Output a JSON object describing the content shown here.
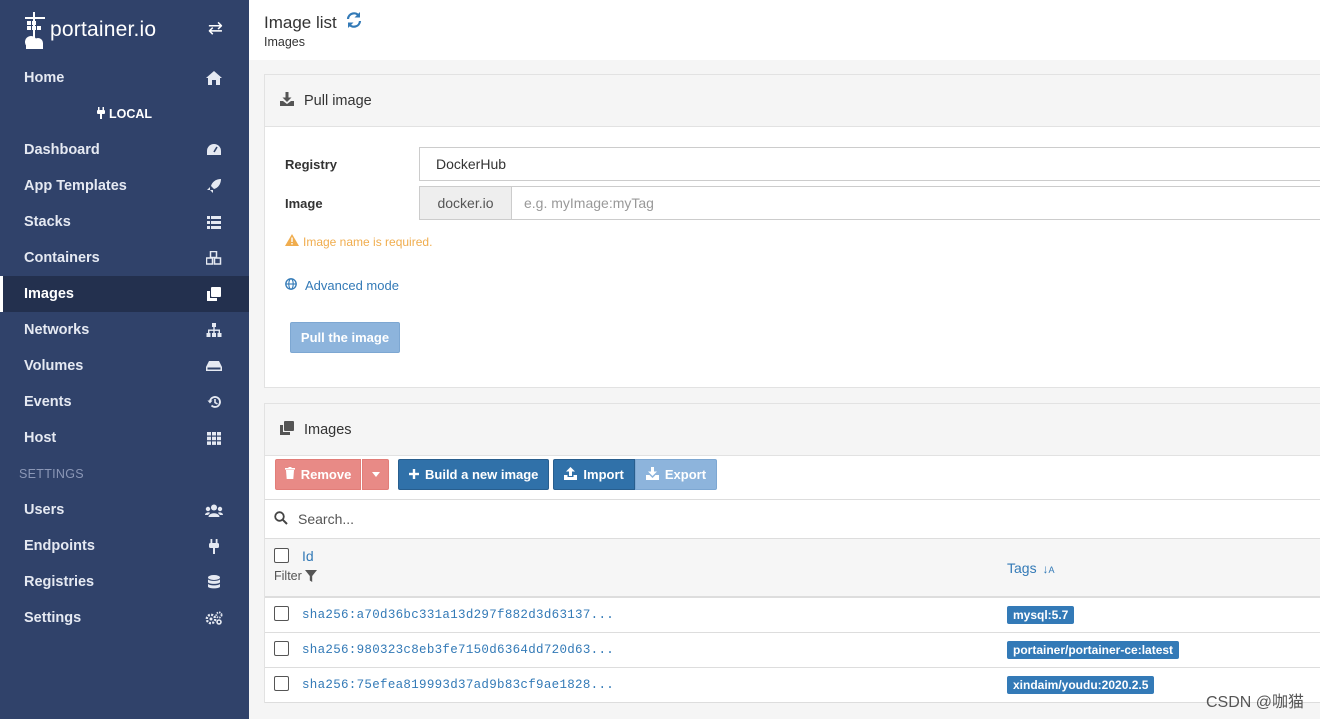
{
  "app": {
    "logo_text": "portainer.io"
  },
  "sidebar": {
    "home": "Home",
    "endpoint": "LOCAL",
    "items": [
      {
        "label": "Dashboard",
        "icon": "tachometer-icon"
      },
      {
        "label": "App Templates",
        "icon": "rocket-icon"
      },
      {
        "label": "Stacks",
        "icon": "list-icon"
      },
      {
        "label": "Containers",
        "icon": "cubes-icon"
      },
      {
        "label": "Images",
        "icon": "clone-icon",
        "active": true
      },
      {
        "label": "Networks",
        "icon": "sitemap-icon"
      },
      {
        "label": "Volumes",
        "icon": "hdd-icon"
      },
      {
        "label": "Events",
        "icon": "history-icon"
      },
      {
        "label": "Host",
        "icon": "th-icon"
      }
    ],
    "settings_title": "SETTINGS",
    "settings_items": [
      {
        "label": "Users",
        "icon": "users-icon"
      },
      {
        "label": "Endpoints",
        "icon": "plug-icon"
      },
      {
        "label": "Registries",
        "icon": "database-icon"
      },
      {
        "label": "Settings",
        "icon": "cogs-icon"
      }
    ]
  },
  "header": {
    "title": "Image list",
    "breadcrumb": "Images"
  },
  "pull_panel": {
    "title": "Pull image",
    "registry_label": "Registry",
    "registry_value": "DockerHub",
    "image_label": "Image",
    "image_prefix": "docker.io",
    "image_placeholder": "e.g. myImage:myTag",
    "warning": "Image name is required.",
    "advanced_mode": "Advanced mode",
    "pull_button": "Pull the image"
  },
  "images_panel": {
    "title": "Images",
    "remove": "Remove",
    "build": "Build a new image",
    "import": "Import",
    "export": "Export",
    "search_placeholder": "Search...",
    "col_id": "Id",
    "filter": "Filter",
    "col_tags": "Tags",
    "rows": [
      {
        "id": "sha256:a70d36bc331a13d297f882d3d63137...",
        "tag": "mysql:5.7"
      },
      {
        "id": "sha256:980323c8eb3fe7150d6364dd720d63...",
        "tag": "portainer/portainer-ce:latest"
      },
      {
        "id": "sha256:75efea819993d37ad9b83cf9ae1828...",
        "tag": "xindaim/youdu:2020.2.5"
      }
    ]
  },
  "watermark": "CSDN @咖猫"
}
